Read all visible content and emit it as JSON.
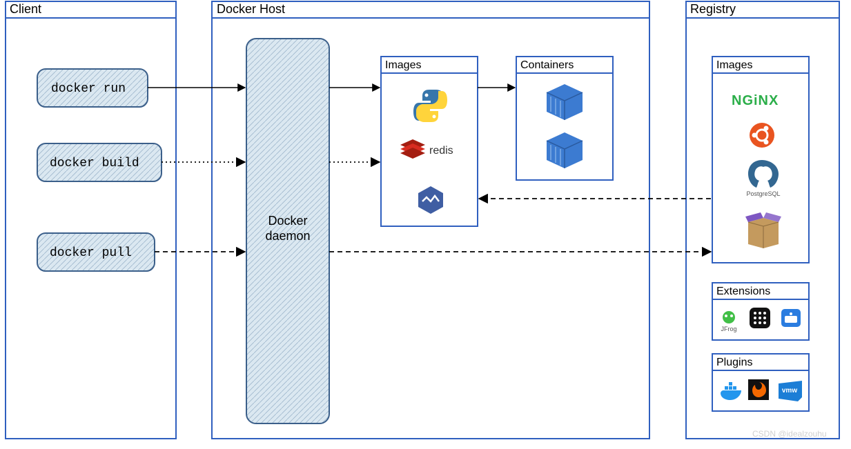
{
  "client": {
    "title": "Client",
    "commands": [
      "docker run",
      "docker build",
      "docker pull"
    ]
  },
  "host": {
    "title": "Docker Host",
    "daemon_label_line1": "Docker",
    "daemon_label_line2": "daemon",
    "images_title": "Images",
    "containers_title": "Containers"
  },
  "registry": {
    "title": "Registry",
    "images_title": "Images",
    "nginx_label": "NGiNX",
    "postgres_label": "PostgreSQL",
    "extensions_title": "Extensions",
    "plugins_title": "Plugins"
  },
  "watermark": "CSDN @idealzouhu",
  "colors": {
    "panel_border": "#2f5fbf",
    "hatch_fill": "#dbe8f1",
    "hatch_line": "#9fb7cc",
    "node_border": "#3b5f8a",
    "container_blue": "#3c7bd1",
    "ubuntu": "#e95420",
    "postgres": "#336791",
    "hex": "#3f5ea3",
    "redis": "#d52b2b",
    "nginx": "#2bae49",
    "grafana": "#f46800",
    "docker": "#2396ed",
    "vmw": "#1c7ed6"
  }
}
